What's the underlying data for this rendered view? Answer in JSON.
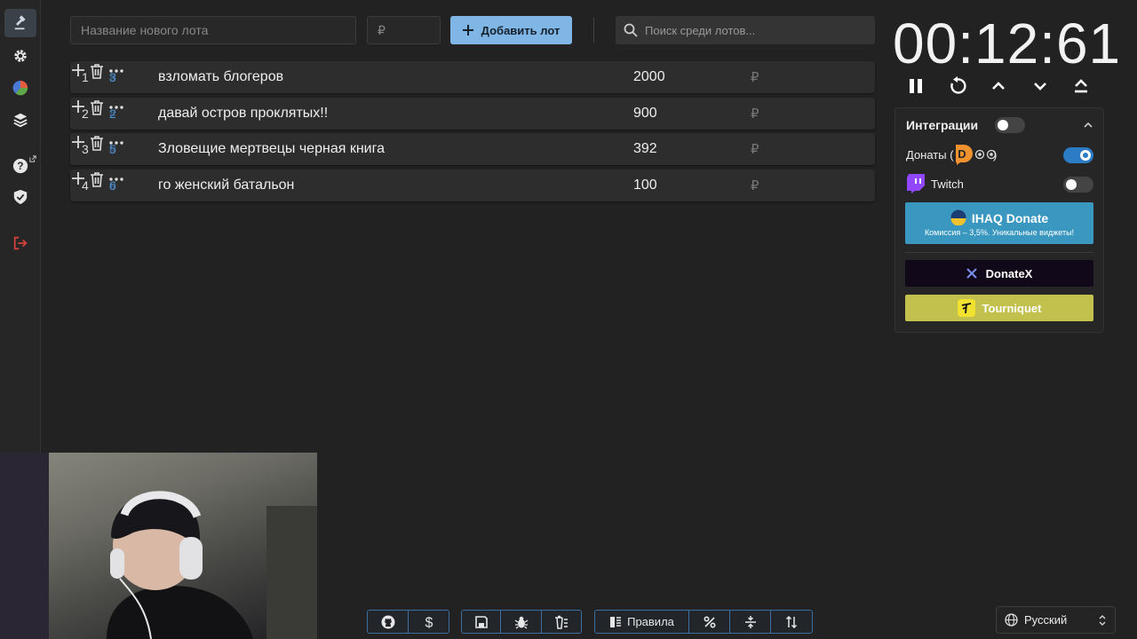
{
  "sidebar": {
    "items": [
      {
        "icon": "auction-gavel-icon"
      },
      {
        "icon": "gear-icon"
      },
      {
        "icon": "pie-wheel-icon"
      },
      {
        "icon": "layers-icon"
      },
      {
        "icon": "help-icon"
      },
      {
        "icon": "shield-check-icon"
      },
      {
        "icon": "logout-icon"
      }
    ]
  },
  "new_lot": {
    "name_placeholder": "Название нового лота",
    "amount_placeholder": "₽",
    "add_label": "Добавить лот"
  },
  "search": {
    "placeholder": "Поиск среди лотов..."
  },
  "lots": [
    {
      "index": "1",
      "id": "3",
      "name": "взломать блогеров",
      "amount": "2000",
      "currency": "₽"
    },
    {
      "index": "2",
      "id": "2",
      "name": "давай остров проклятых!!",
      "amount": "900",
      "currency": "₽"
    },
    {
      "index": "3",
      "id": "5",
      "name": "Зловещие мертвецы черная книга",
      "amount": "392",
      "currency": "₽"
    },
    {
      "index": "4",
      "id": "6",
      "name": "го женский батальон",
      "amount": "100",
      "currency": "₽"
    }
  ],
  "timer": {
    "value": "00:12:61"
  },
  "integrations": {
    "title": "Интеграции",
    "enabled": false,
    "donations_label": "Донаты (",
    "donations_suffix": ")",
    "donations_enabled": true,
    "twitch_label": "Twitch",
    "twitch_enabled": false,
    "ihaq": {
      "title": "IHAQ Donate",
      "subtitle": "Комиссия – 3,5%. Уникальные виджеты!"
    },
    "donatex": {
      "title": "DonateX"
    },
    "tourniquet": {
      "title": "Tourniquet"
    }
  },
  "bottom_toolbar": {
    "rules_label": "Правила"
  },
  "language": {
    "selected": "Русский"
  },
  "colors": {
    "accent": "#7fb6e6",
    "id_link": "#4f8fd1",
    "toggle_on": "#2b7bc5",
    "ihaq": "#3a97c0",
    "tourniquet": "#c3c14d",
    "donatex": "#11081a"
  }
}
